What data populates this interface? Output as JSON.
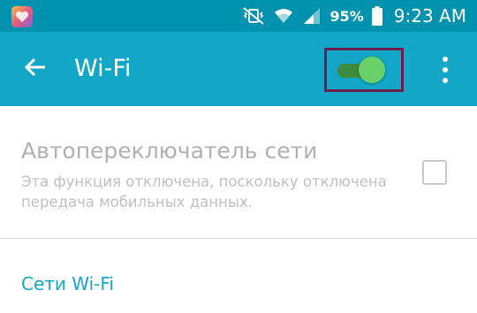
{
  "status_bar": {
    "app_icon": "heart-app-icon",
    "icons": [
      "mute-vibrate-icon",
      "wifi-signal-icon",
      "cell-signal-icon",
      "battery-icon"
    ],
    "battery_percent": "95%",
    "time": "9:23 AM",
    "background": "#0092ae"
  },
  "action_bar": {
    "title": "Wi-Fi",
    "back_icon": "arrow-left-icon",
    "wifi_toggle_on": true,
    "more_icon": "more-vertical-icon",
    "background": "#12a7c6",
    "toggle_color": "#69d167"
  },
  "network_switch": {
    "title": "Автопереключатель сети",
    "description": "Эта функция отключена, поскольку отключена передача мобильных данных.",
    "checked": false,
    "enabled": false
  },
  "section": {
    "header": "Сети Wi-Fi",
    "accent": "#16a7c4"
  }
}
